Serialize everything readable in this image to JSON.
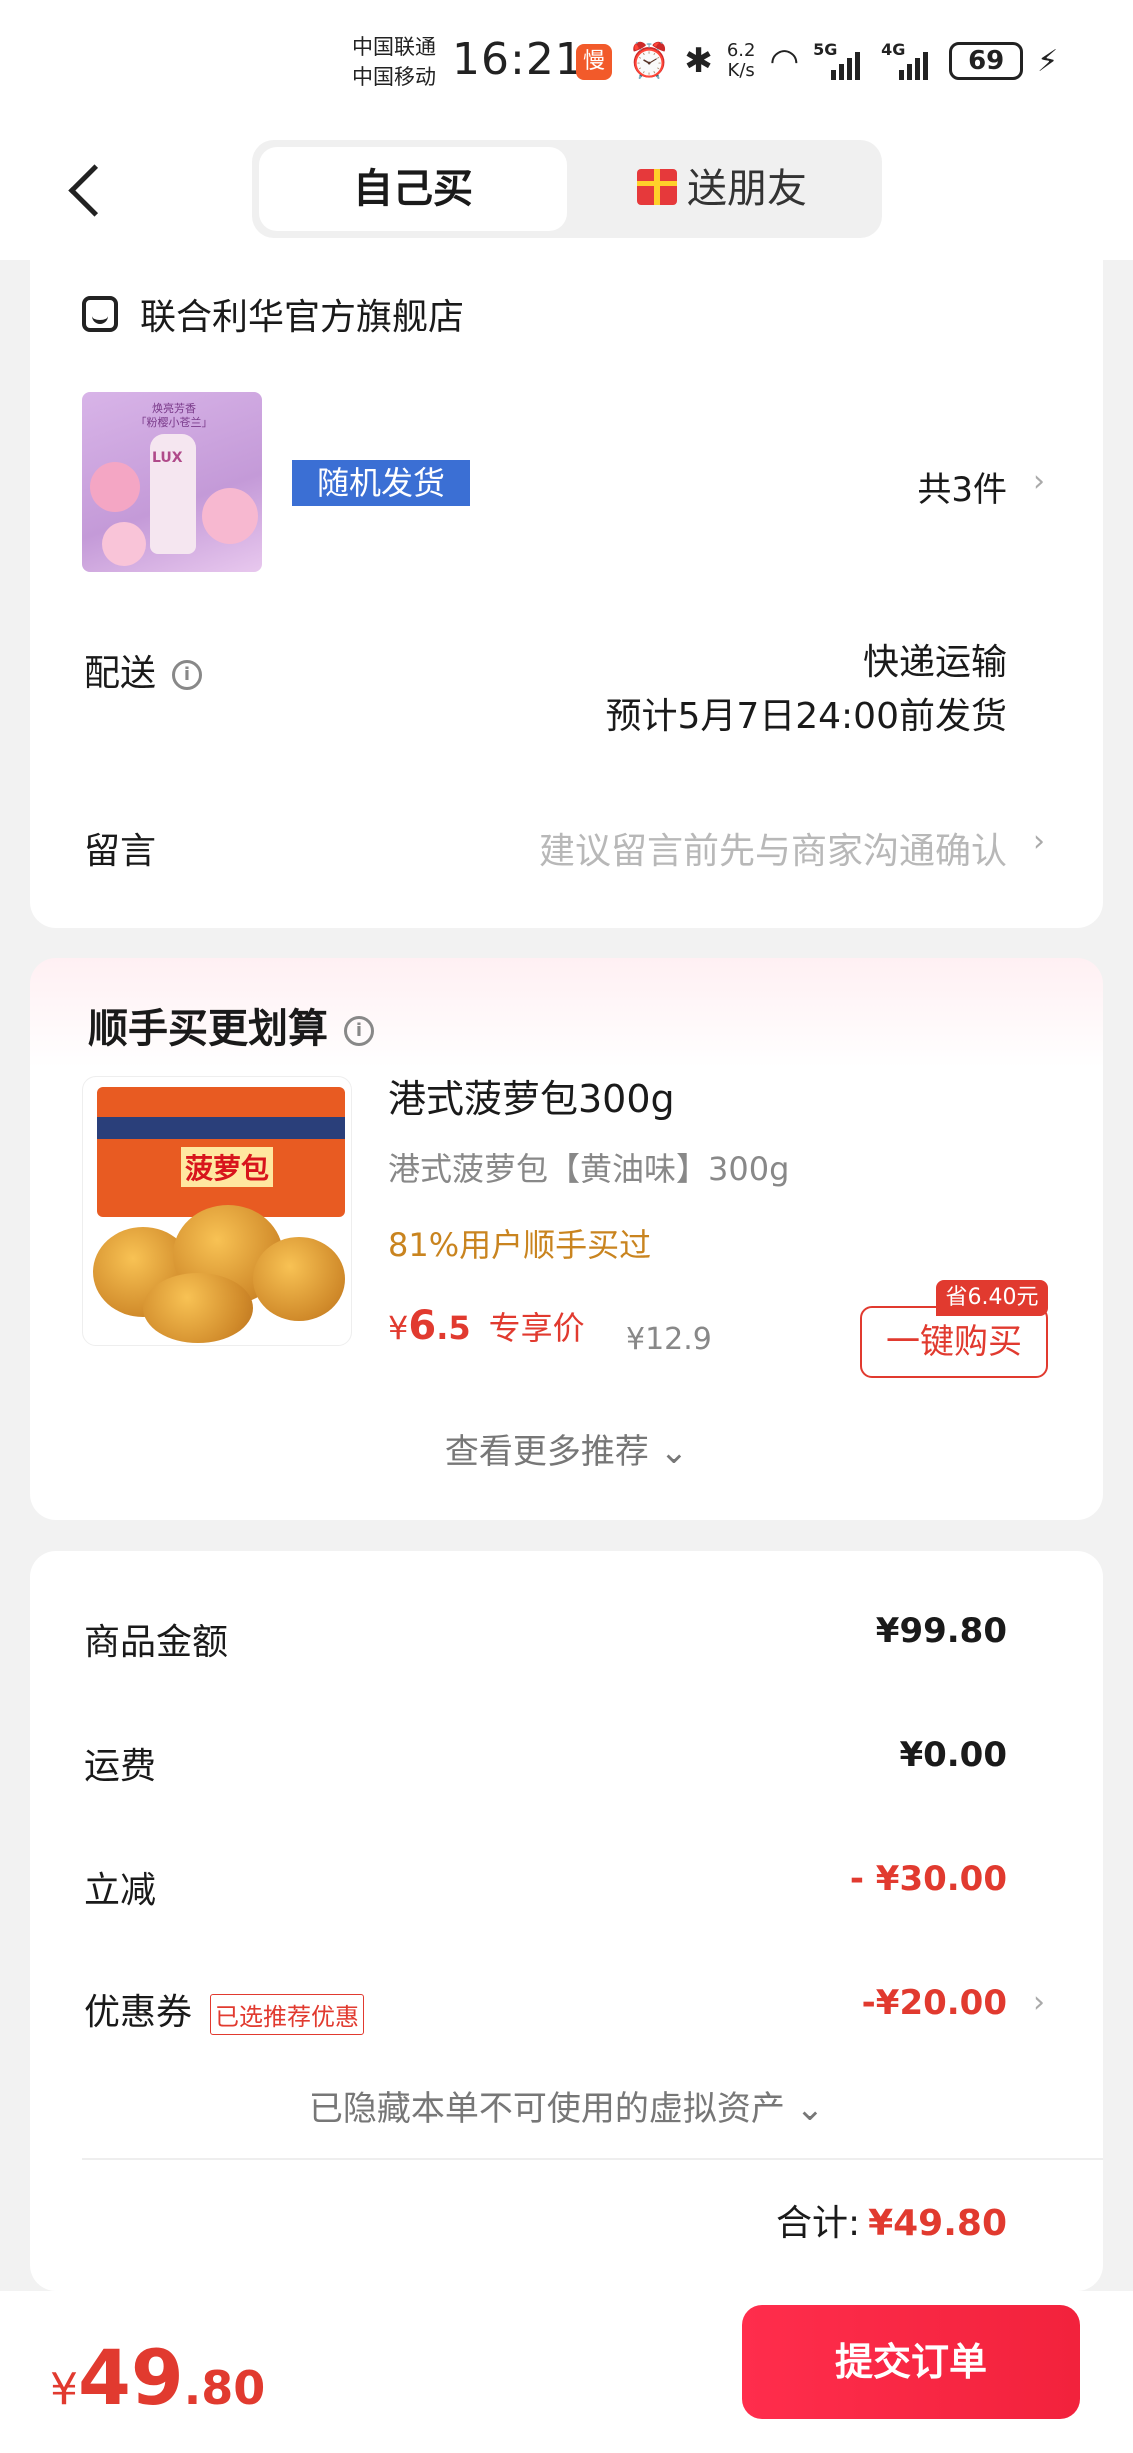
{
  "status_bar": {
    "carrier1": "中国联通",
    "carrier2": "中国移动",
    "time": "16:21",
    "app_badge": "慢",
    "net_speed_value": "6.2",
    "net_speed_unit": "K/s",
    "signal1": "5G",
    "signal2": "4G",
    "battery": "69"
  },
  "header": {
    "tab_self": "自己买",
    "tab_gift": "送朋友"
  },
  "order": {
    "shop_name": "联合利华官方旗舰店",
    "product_img_text": "焕亮芳香",
    "product_img_sub": "「粉樱小苍兰」",
    "product_brand": "LUX",
    "random_tag": "随机发货",
    "quantity": "共3件",
    "delivery_label": "配送",
    "delivery_method": "快递运输",
    "delivery_eta": "预计5月7日24:00前发货",
    "message_label": "留言",
    "message_placeholder": "建议留言前先与商家沟通确认"
  },
  "recommend": {
    "title": "顺手买更划算",
    "box_text": "菠萝包",
    "name": "港式菠萝包300g",
    "sub": "港式菠萝包【黄油味】300g",
    "percent_text": "81%用户顺手买过",
    "price_symbol": "¥",
    "price_int": "6",
    "price_dec": ".5",
    "price_tag": "专享价",
    "orig_price": "¥12.9",
    "save_tag": "省6.40元",
    "buy_btn": "一键购买",
    "more": "查看更多推荐"
  },
  "summary": {
    "items": [
      {
        "label": "商品金额",
        "value": "¥99.80"
      },
      {
        "label": "运费",
        "value": "¥0.00"
      },
      {
        "label": "立减",
        "value": "- ¥30.00"
      },
      {
        "label": "优惠券",
        "value": "-¥20.00",
        "badge": "已选推荐优惠"
      }
    ],
    "hidden_assets": "已隐藏本单不可使用的虚拟资产",
    "total_label": "合计:",
    "total_value": "¥49.80"
  },
  "bottom": {
    "symbol": "¥",
    "int": "49",
    "dec": ".80",
    "submit": "提交订单"
  },
  "colors": {
    "accent_red": "#e13a2f",
    "tag_blue": "#3b6fd4",
    "orange": "#c9841f"
  }
}
